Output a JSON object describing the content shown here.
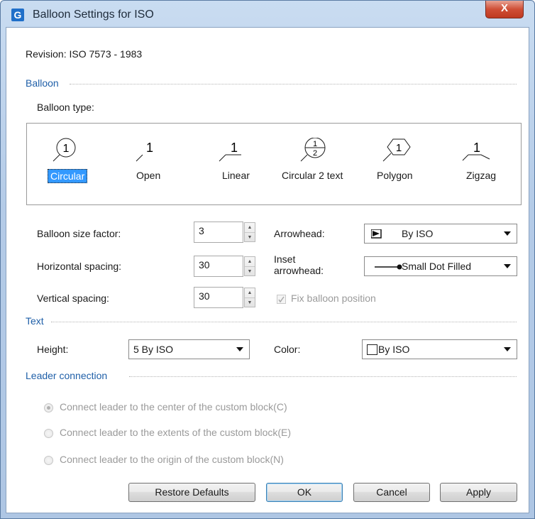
{
  "window": {
    "title": "Balloon Settings for ISO",
    "close_label": "X"
  },
  "revision": "Revision: ISO 7573 - 1983",
  "balloon_section": {
    "title": "Balloon",
    "type_label": "Balloon type:",
    "types": [
      {
        "label": "Circular",
        "glyph": "1",
        "selected": true
      },
      {
        "label": "Open",
        "glyph": "1"
      },
      {
        "label": "Linear",
        "glyph": "1"
      },
      {
        "label": "Circular 2 text",
        "glyph_top": "1",
        "glyph_bottom": "2"
      },
      {
        "label": "Polygon",
        "glyph": "1"
      },
      {
        "label": "Zigzag",
        "glyph": "1"
      }
    ],
    "size_factor_label": "Balloon size factor:",
    "size_factor_value": "3",
    "h_spacing_label": "Horizontal spacing:",
    "h_spacing_value": "30",
    "v_spacing_label": "Vertical spacing:",
    "v_spacing_value": "30",
    "arrowhead_label": "Arrowhead:",
    "arrowhead_value": "By ISO",
    "inset_label_1": "Inset",
    "inset_label_2": "arrowhead:",
    "inset_value": "Small Dot Filled",
    "fix_position_label": "Fix balloon position"
  },
  "text_section": {
    "title": "Text",
    "height_label": "Height:",
    "height_value": "5 By ISO",
    "color_label": "Color:",
    "color_value": "By ISO"
  },
  "leader_section": {
    "title": "Leader connection",
    "options": [
      "Connect leader to the center of the custom block(C)",
      "Connect leader to the extents of the custom block(E)",
      "Connect leader to the origin of the custom block(N)"
    ]
  },
  "buttons": {
    "restore": "Restore Defaults",
    "ok": "OK",
    "cancel": "Cancel",
    "apply": "Apply"
  },
  "colors": {
    "accent": "#1f5fa8",
    "selection": "#3399ff"
  }
}
